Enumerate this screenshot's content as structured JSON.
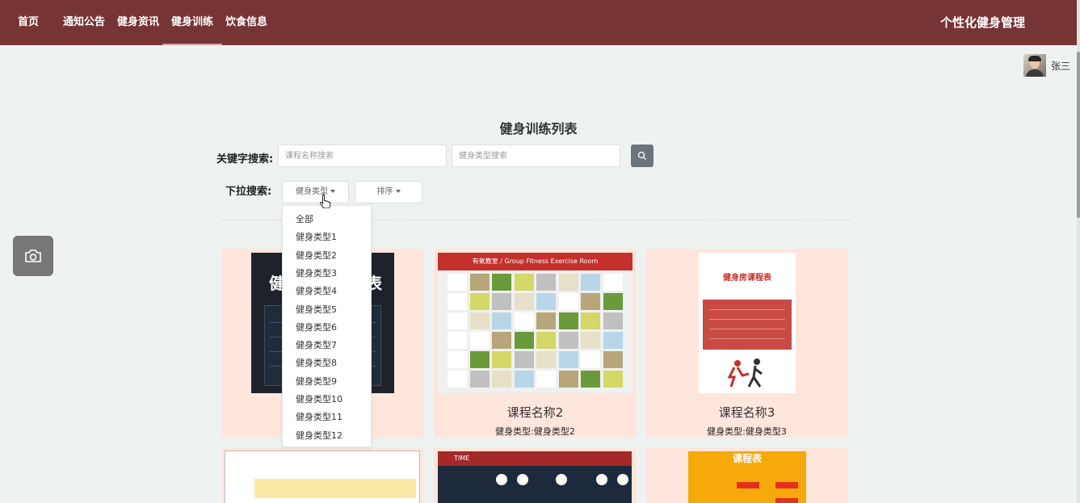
{
  "nav": {
    "items": [
      {
        "label": "首页"
      },
      {
        "label": "通知公告"
      },
      {
        "label": "健身资讯"
      },
      {
        "label": "健身训练"
      },
      {
        "label": "饮食信息"
      }
    ],
    "active_index": 3,
    "brand": "个性化健身管理"
  },
  "user": {
    "name": "张三"
  },
  "page": {
    "title": "健身训练列表"
  },
  "search": {
    "keyword_label": "关键字搜索:",
    "course_placeholder": "课程名称搜索",
    "type_placeholder": "健身类型搜索",
    "search_icon": "search-icon"
  },
  "filter": {
    "label": "下拉搜索:",
    "type_button": "健身类型",
    "sort_button": "排序",
    "type_options": [
      "全部",
      "健身类型1",
      "健身类型2",
      "健身类型3",
      "健身类型4",
      "健身类型5",
      "健身类型6",
      "健身类型7",
      "健身类型8",
      "健身类型9",
      "健身类型10",
      "健身类型11",
      "健身类型12"
    ]
  },
  "cards": [
    {
      "title": "",
      "type": ""
    },
    {
      "title": "课程名称2",
      "type": "健身类型:健身类型2"
    },
    {
      "title": "课程名称3",
      "type": "健身类型:健身类型3"
    },
    {
      "title": "",
      "type": ""
    },
    {
      "title": "",
      "type": ""
    },
    {
      "title": "",
      "type": ""
    }
  ],
  "posters": {
    "p1_title_left": "健",
    "p1_title_right": "表",
    "p2_header": "有氧教室 / Group Fitness Exercise Room",
    "p3_title": "健身房课程表",
    "p5_time": "TIME",
    "p6_title": "课程表"
  },
  "colors": {
    "nav_bg": "#773434",
    "card_bg": "#ffe6dc",
    "page_bg": "#eef3f2"
  }
}
